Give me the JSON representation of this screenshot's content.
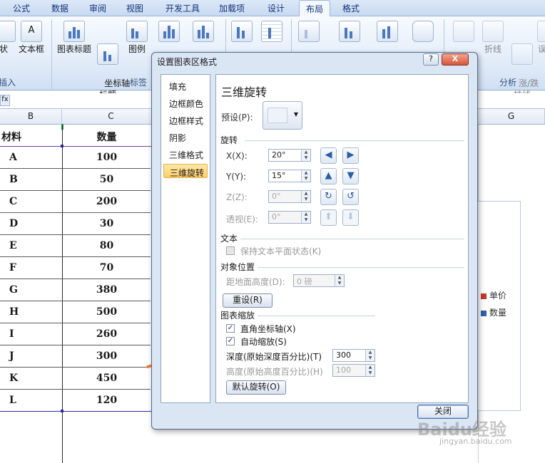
{
  "ribbon": {
    "tabs": [
      "公式",
      "数据",
      "审阅",
      "视图",
      "开发工具",
      "加载项",
      "设计",
      "布局",
      "格式"
    ],
    "active_tab": "布局",
    "buttons": {
      "b0": "状",
      "b1": "文本框",
      "b2": "图表标题",
      "b3": "坐标轴\n标题",
      "b4": "图例",
      "b5": "折线",
      "b6": "涨/跌\n柱线",
      "b7": "误"
    },
    "groups": {
      "insert": "插入",
      "labels": "标签",
      "analysis": "分析"
    },
    "accent": "#15317a"
  },
  "formula_bar": {
    "fx": "fx"
  },
  "sheet": {
    "col_headers": {
      "B": "B",
      "C": "C",
      "G": "G"
    },
    "header_row": {
      "material": "材料",
      "qty": "数量"
    },
    "rows": [
      {
        "material": "A",
        "qty": "100"
      },
      {
        "material": "B",
        "qty": "50"
      },
      {
        "material": "C",
        "qty": "200"
      },
      {
        "material": "D",
        "qty": "30"
      },
      {
        "material": "E",
        "qty": "80"
      },
      {
        "material": "F",
        "qty": "70"
      },
      {
        "material": "G",
        "qty": "380"
      },
      {
        "material": "H",
        "qty": "500"
      },
      {
        "material": "I",
        "qty": "260"
      },
      {
        "material": "J",
        "qty": "300"
      },
      {
        "material": "K",
        "qty": "450"
      },
      {
        "material": "L",
        "qty": "120"
      }
    ]
  },
  "chart_legend": [
    {
      "label": "单价",
      "color": "#c0392b"
    },
    {
      "label": "数量",
      "color": "#2e5ea8"
    }
  ],
  "dialog": {
    "title": "设置图表区格式",
    "help_btn": "?",
    "close_btn": "X",
    "nav": [
      "填充",
      "边框颜色",
      "边框样式",
      "阴影",
      "三维格式",
      "三维旋转"
    ],
    "selected_nav": "三维旋转",
    "panel_title": "三维旋转",
    "preset_label": "预设(P):",
    "rotation": {
      "section": "旋转",
      "x_label": "X(X):",
      "x_value": "20°",
      "y_label": "Y(Y):",
      "y_value": "15°",
      "z_label": "Z(Z):",
      "z_value": "0°",
      "persp_label": "透视(E):",
      "persp_value": "0°"
    },
    "text": {
      "section": "文本",
      "keep_flat": "保持文本平面状态(K)"
    },
    "object_pos": {
      "section": "对象位置",
      "distance_label": "距地面高度(D):",
      "distance_value": "0 磅"
    },
    "reset_btn": "重设(R)",
    "scaling": {
      "section": "图表缩放",
      "right_angle": "直角坐标轴(X)",
      "autoscale": "自动缩放(S)",
      "depth_label": "深度(原始深度百分比)(T)",
      "depth_value": "300",
      "height_label": "高度(原始高度百分比)(H)",
      "height_value": "100"
    },
    "default_rotation_btn": "默认旋转(O)",
    "close_label": "关闭"
  },
  "watermark": {
    "main": "Baidu经验",
    "sub": "jingyan.baidu.com"
  }
}
